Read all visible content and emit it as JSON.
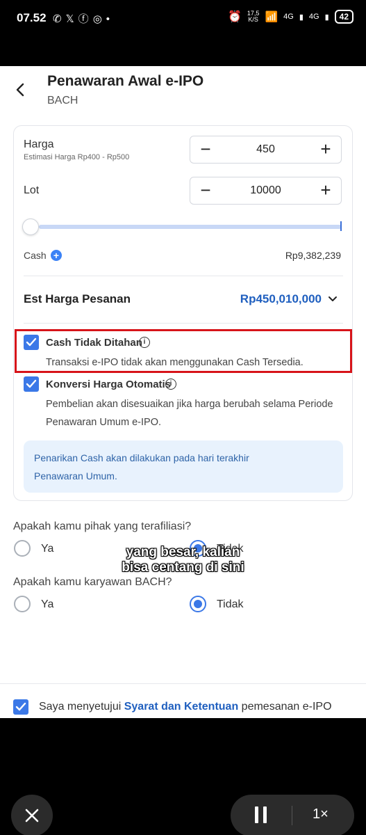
{
  "status_bar": {
    "time": "07.52",
    "left_icons": [
      "whatsapp-icon",
      "x-icon",
      "facebook-icon",
      "instagram-icon",
      "dot-icon"
    ],
    "speed_value": "17,5",
    "speed_unit": "K/S",
    "network_1": "4G",
    "network_2": "4G",
    "battery": "42"
  },
  "header": {
    "title": "Penawaran Awal e-IPO",
    "subtitle": "BACH"
  },
  "form": {
    "harga": {
      "label": "Harga",
      "hint": "Estimasi Harga Rp400 - Rp500",
      "value": "450"
    },
    "lot": {
      "label": "Lot",
      "value": "10000"
    },
    "cash": {
      "label": "Cash",
      "value": "Rp9,382,239"
    },
    "est_harga": {
      "label": "Est Harga Pesanan",
      "value": "Rp450,010,000"
    },
    "cash_tidak_ditahan": {
      "checked": true,
      "title": "Cash Tidak Ditahan",
      "desc": "Transaksi e-IPO tidak akan menggunakan Cash Tersedia."
    },
    "konversi_harga": {
      "checked": true,
      "title": "Konversi Harga Otomatis",
      "desc_line1": "Pembelian akan disesuaikan jika harga berubah selama Periode",
      "desc_line2": "Penawaran Umum e-IPO."
    },
    "notice": {
      "line1": "Penarikan Cash akan dilakukan pada hari terakhir",
      "line2": "Penawaran Umum."
    }
  },
  "questions": {
    "affiliated": {
      "label": "Apakah kamu pihak yang terafiliasi?",
      "option_yes": "Ya",
      "option_no": "Tidak",
      "selected": "Tidak"
    },
    "employee": {
      "label": "Apakah kamu karyawan BACH?",
      "option_yes": "Ya",
      "option_no": "Tidak",
      "selected": "Tidak"
    }
  },
  "video_caption": {
    "line1": "yang besar, kalian",
    "line2": "bisa centang di sini"
  },
  "agreement": {
    "checked": true,
    "prefix": "Saya menyetujui ",
    "link": "Syarat dan Ketentuan",
    "suffix": " pemesanan e-IPO"
  },
  "player": {
    "speed": "1×"
  },
  "colors": {
    "accent": "#3b78e7",
    "link": "#1f5fbf",
    "highlight": "#d7141a",
    "notice_bg": "#e8f2fd"
  }
}
